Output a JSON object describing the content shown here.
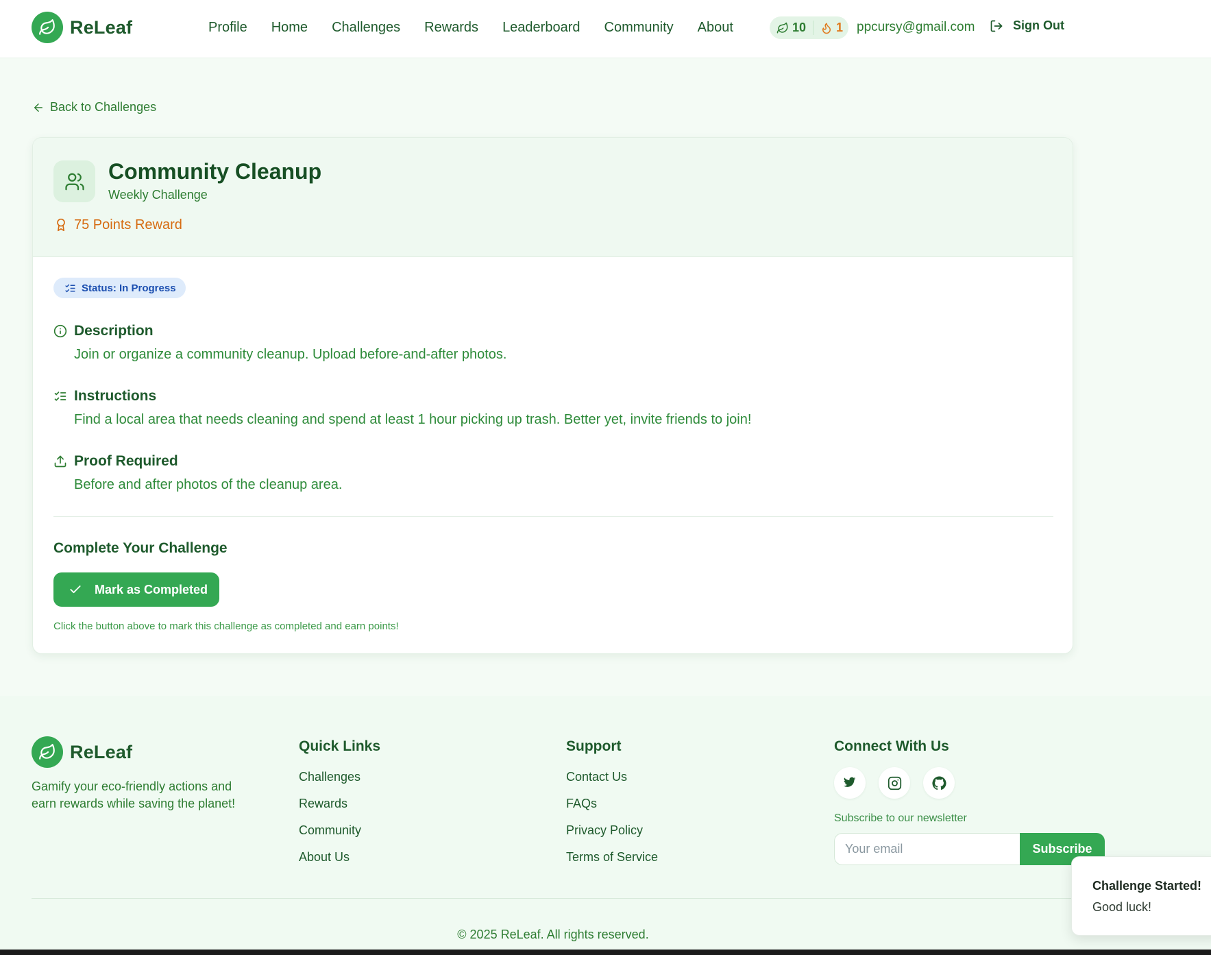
{
  "header": {
    "brand": "ReLeaf",
    "nav": [
      "Profile",
      "Home",
      "Challenges",
      "Rewards",
      "Leaderboard",
      "Community",
      "About"
    ],
    "leaf_points": "10",
    "streak": "1",
    "user_email": "ppcursy@gmail.com",
    "sign_out": "Sign Out"
  },
  "main": {
    "back_link": "Back to Challenges",
    "challenge": {
      "title": "Community Cleanup",
      "frequency": "Weekly Challenge",
      "points_reward": "75 Points Reward",
      "status": "Status: In Progress",
      "description_heading": "Description",
      "description": "Join or organize a community cleanup. Upload before-and-after photos.",
      "instructions_heading": "Instructions",
      "instructions": "Find a local area that needs cleaning and spend at least 1 hour picking up trash. Better yet, invite friends to join!",
      "proof_heading": "Proof Required",
      "proof": "Before and after photos of the cleanup area."
    },
    "complete_heading": "Complete Your Challenge",
    "complete_button": "Mark as Completed",
    "complete_hint": "Click the button above to mark this challenge as completed and earn points!"
  },
  "footer": {
    "brand": "ReLeaf",
    "tagline": "Gamify your eco-friendly actions and earn rewards while saving the planet!",
    "quick_links": {
      "heading": "Quick Links",
      "items": [
        "Challenges",
        "Rewards",
        "Community",
        "About Us"
      ]
    },
    "support": {
      "heading": "Support",
      "items": [
        "Contact Us",
        "FAQs",
        "Privacy Policy",
        "Terms of Service"
      ]
    },
    "connect": {
      "heading": "Connect With Us",
      "socials": [
        "twitter-icon",
        "instagram-icon",
        "github-icon"
      ],
      "newsletter_label": "Subscribe to our newsletter",
      "email_placeholder": "Your email",
      "subscribe_button": "Subscribe"
    },
    "copyright": "© 2025 ReLeaf. All rights reserved."
  },
  "toast": {
    "title": "Challenge Started!",
    "message": "Good luck!"
  },
  "colors": {
    "brand_green": "#34a853",
    "dark_green": "#1e5a2c",
    "reward_orange": "#d66c12",
    "status_blue": "#1c4fb0"
  }
}
